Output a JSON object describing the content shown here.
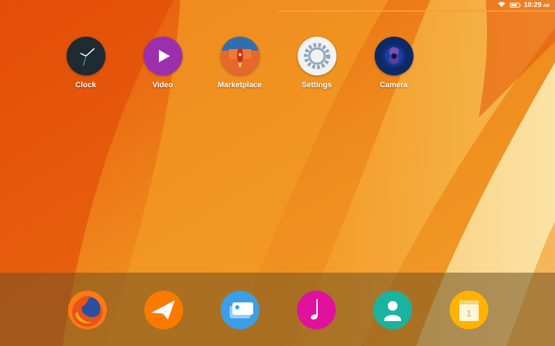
{
  "status_bar": {
    "time": "10:29",
    "ampm": "AM",
    "battery_level": 0.8,
    "wifi_icon": "wifi-icon",
    "battery_icon": "battery-icon"
  },
  "apps": [
    {
      "label": "Clock",
      "icon": "clock-icon",
      "color": "#1f2a33"
    },
    {
      "label": "Video",
      "icon": "play-icon",
      "color": "#9b2fae"
    },
    {
      "label": "Marketplace",
      "icon": "rocket-icon",
      "color": "#e4692b"
    },
    {
      "label": "Settings",
      "icon": "gear-icon",
      "color": "#f2f2f2"
    },
    {
      "label": "Camera",
      "icon": "camera-icon",
      "color": "#0d2a66"
    }
  ],
  "dock": [
    {
      "icon": "firefox-icon",
      "color": "#ff6611"
    },
    {
      "icon": "paper-plane-icon",
      "color": "#ff8a00"
    },
    {
      "icon": "gallery-icon",
      "color": "#3b9fe8"
    },
    {
      "icon": "music-note-icon",
      "color": "#e0119c"
    },
    {
      "icon": "contacts-icon",
      "color": "#1ab39f"
    },
    {
      "icon": "calendar-icon",
      "color": "#ffb300"
    }
  ],
  "calendar_day": "1",
  "colors": {
    "wallpaper_orange": "#e8650f",
    "wallpaper_yellow": "#f5b23a",
    "wallpaper_cream": "#f7cf7a"
  }
}
